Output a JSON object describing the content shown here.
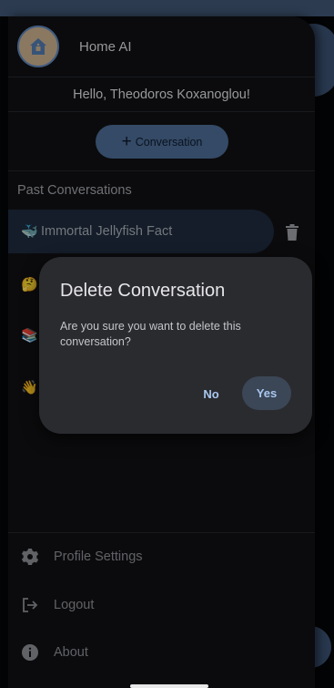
{
  "app": {
    "name": "Home AI"
  },
  "drawer": {
    "greeting": "Hello, Theodoros Koxanoglou!",
    "new_conversation_label": "Conversation",
    "past_title": "Past Conversations",
    "conversations": [
      {
        "emoji": "🐳",
        "title": "Immortal Jellyfish Fact",
        "active": true
      },
      {
        "emoji": "🤔",
        "title": ""
      },
      {
        "emoji": "📚",
        "title": ""
      },
      {
        "emoji": "👋",
        "title": ""
      }
    ],
    "bottom_menu": [
      {
        "label": "Profile Settings",
        "icon": "gear-icon"
      },
      {
        "label": "Logout",
        "icon": "logout-icon"
      },
      {
        "label": "About",
        "icon": "info-icon"
      }
    ]
  },
  "dialog": {
    "title": "Delete Conversation",
    "message": "Are you sure you want to delete this conversation?",
    "no_label": "No",
    "yes_label": "Yes"
  },
  "colors": {
    "accent": "#4b6a92",
    "dialog_button_text": "#a9c7ee",
    "drawer_bg": "#101114",
    "dialog_bg": "#2a2b2f"
  }
}
